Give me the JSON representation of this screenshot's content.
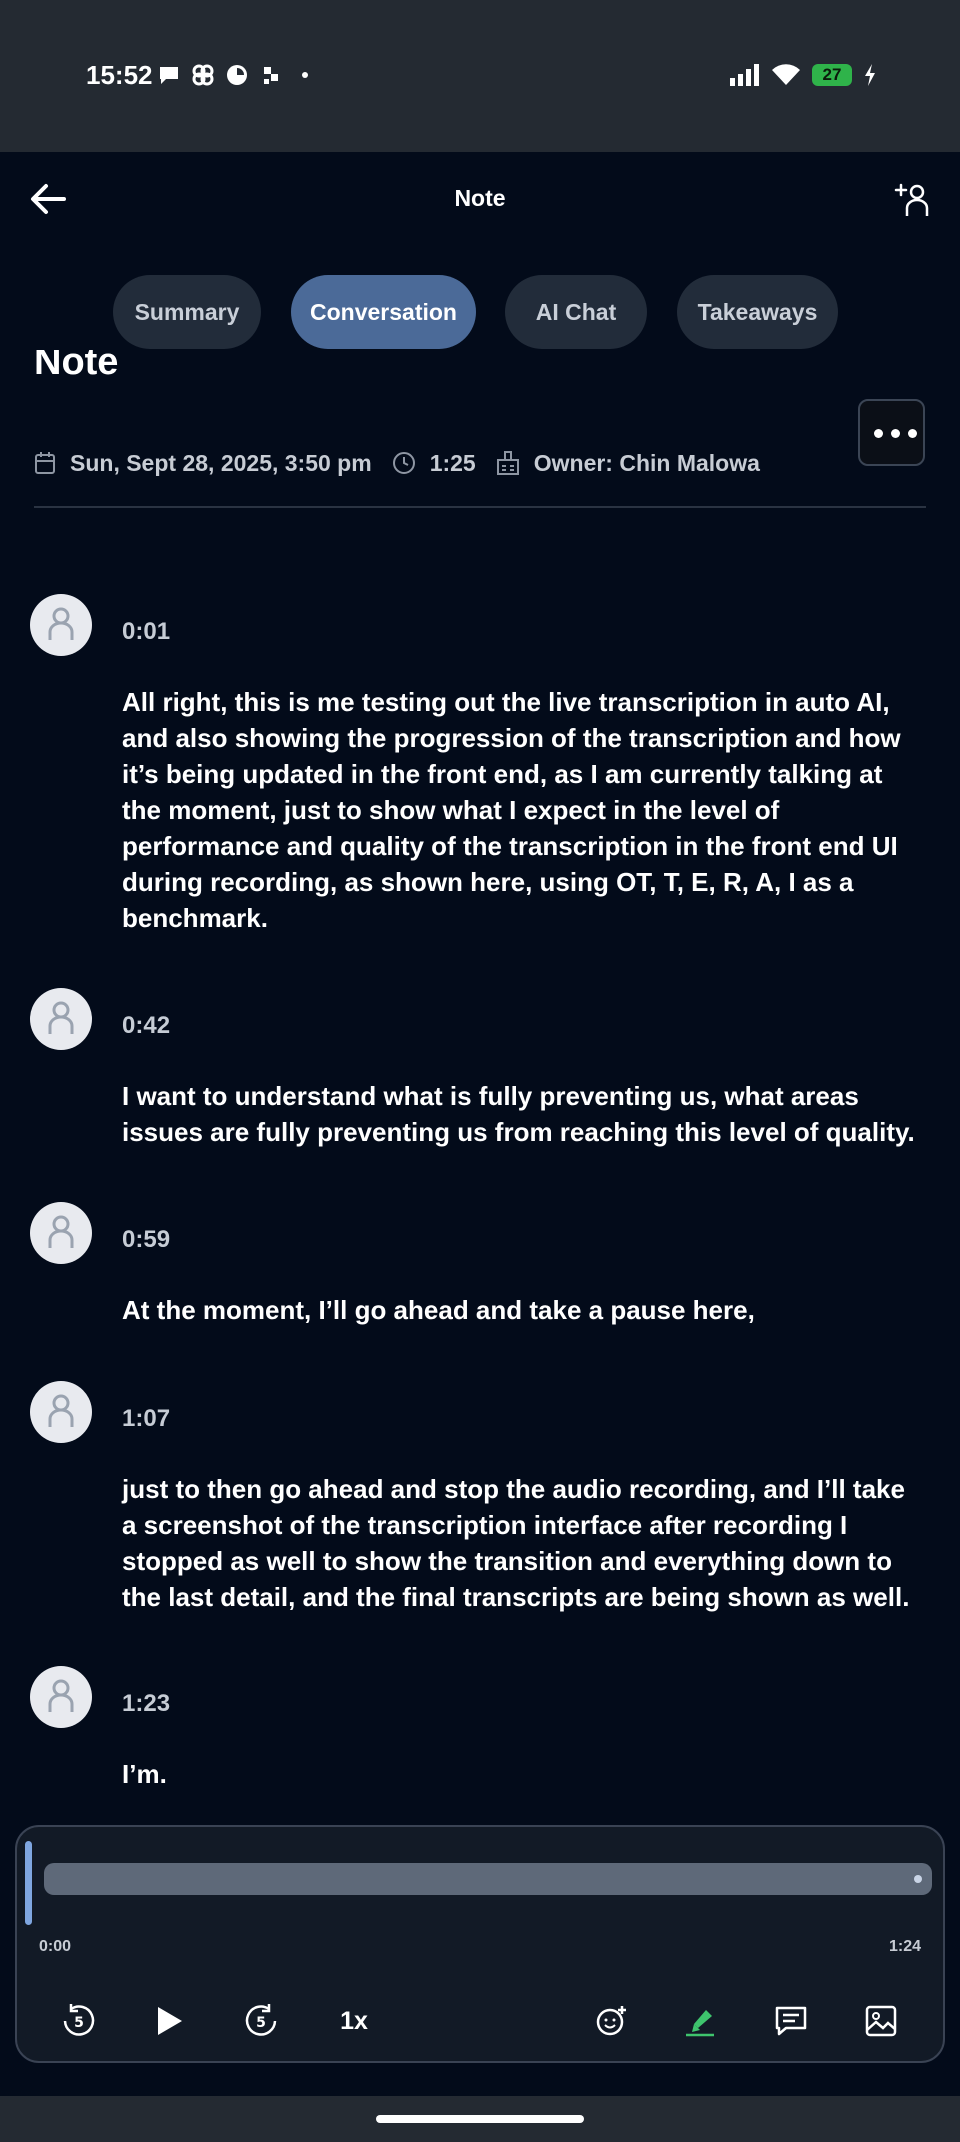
{
  "status": {
    "time": "15:52",
    "battery": "27"
  },
  "header": {
    "title": "Note"
  },
  "tabs": [
    {
      "label": "Summary"
    },
    {
      "label": "Conversation"
    },
    {
      "label": "AI Chat"
    },
    {
      "label": "Takeaways"
    }
  ],
  "active_tab": "Conversation",
  "note": {
    "title": "Note",
    "date": "Sun, Sept 28, 2025, 3:50 pm",
    "duration": "1:25",
    "owner": "Owner: Chin Malowa"
  },
  "transcript": [
    {
      "time": "0:01",
      "text": "All right, this is me testing out the live transcription in auto AI, and also showing the progression of the transcription and how it’s being updated in the front end, as I am currently talking at the moment, just to show what I expect in the level of performance and quality of the transcription in the front end UI during recording, as shown here, using OT, T, E, R, A, I as a benchmark."
    },
    {
      "time": "0:42",
      "text": "I want to understand what is fully preventing us, what areas issues are fully preventing us from reaching this level of quality."
    },
    {
      "time": "0:59",
      "text": "At the moment, I’ll go ahead and take a pause here,"
    },
    {
      "time": "1:07",
      "text": "just to then go ahead and stop the audio recording, and I’ll take a screenshot of the transcription interface after recording I stopped as well to show the transition and everything down to the last detail, and the final transcripts are being shown as well."
    },
    {
      "time": "1:23",
      "text": "I’m."
    }
  ],
  "player": {
    "current_time": "0:00",
    "total_time": "1:24",
    "speed": "1x",
    "progress": 0.0
  },
  "icons": {
    "back": "arrow-left-icon",
    "share": "add-person-icon",
    "more": "ellipsis-icon",
    "calendar": "calendar-icon",
    "clock": "clock-icon",
    "owner": "owner-icon",
    "avatar": "person-icon",
    "rewind": "rewind-5-icon",
    "play": "play-icon",
    "forward": "forward-5-icon",
    "emoji": "emoji-add-icon",
    "highlight": "highlighter-icon",
    "comment": "comment-icon",
    "image": "image-icon"
  }
}
